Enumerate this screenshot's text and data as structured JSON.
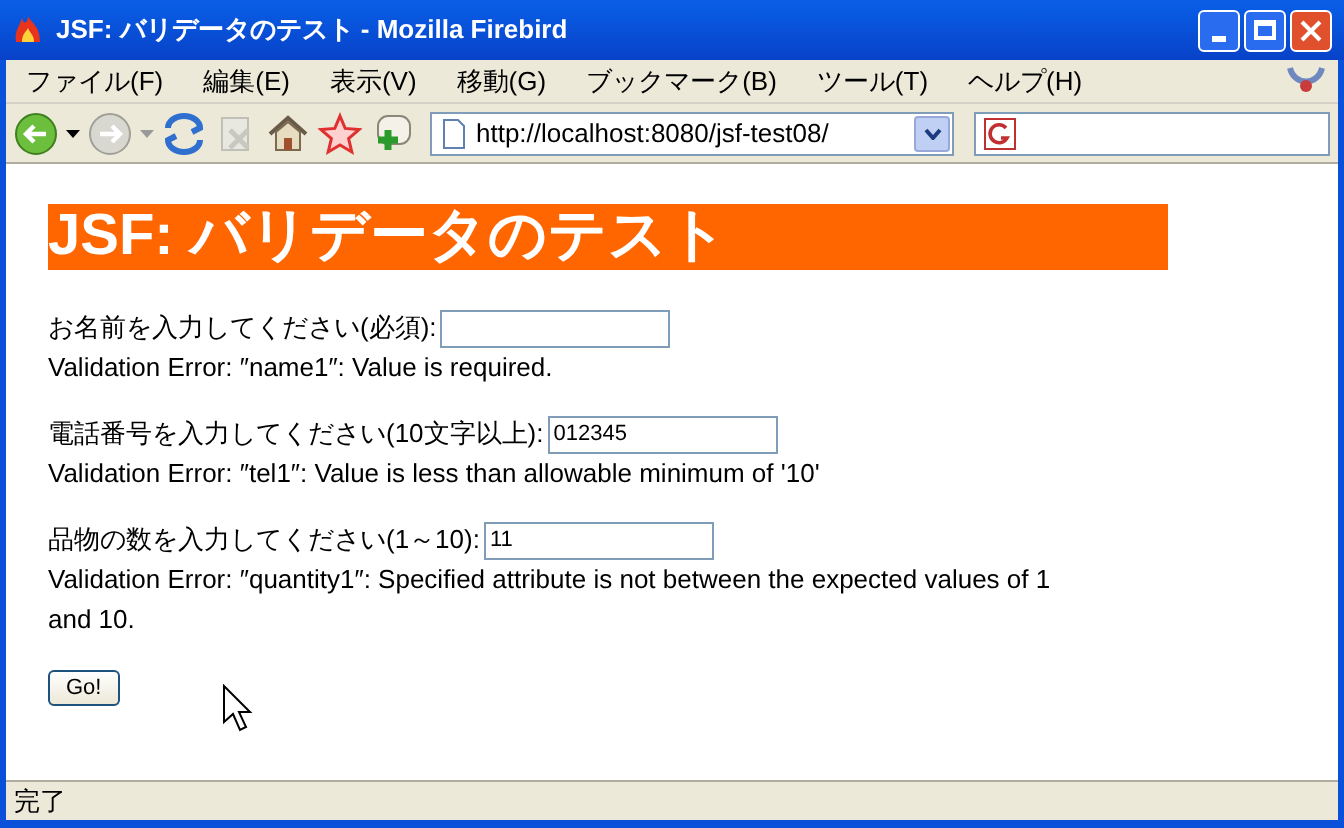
{
  "window": {
    "title": "JSF: バリデータのテスト - Mozilla Firebird"
  },
  "menu": [
    "ファイル(F)",
    "編集(E)",
    "表示(V)",
    "移動(G)",
    "ブックマーク(B)",
    "ツール(T)",
    "ヘルプ(H)"
  ],
  "address_bar": {
    "value": "http://localhost:8080/jsf-test08/"
  },
  "page": {
    "heading": "JSF: バリデータのテスト",
    "fields": [
      {
        "label": "お名前を入力してください(必須):",
        "error": "Validation Error: ″name1″: Value is required."
      },
      {
        "label": "電話番号を入力してください(10文字以上):",
        "value": "012345",
        "error": "Validation Error: ″tel1″: Value is less than allowable minimum of '10'"
      },
      {
        "label": "品物の数を入力してください(1～10):",
        "value": "11",
        "error": "Validation Error: ″quantity1″: Specified attribute is not between the expected values of 1 and 10."
      }
    ],
    "submit": "Go!"
  },
  "status_bar": "完了"
}
